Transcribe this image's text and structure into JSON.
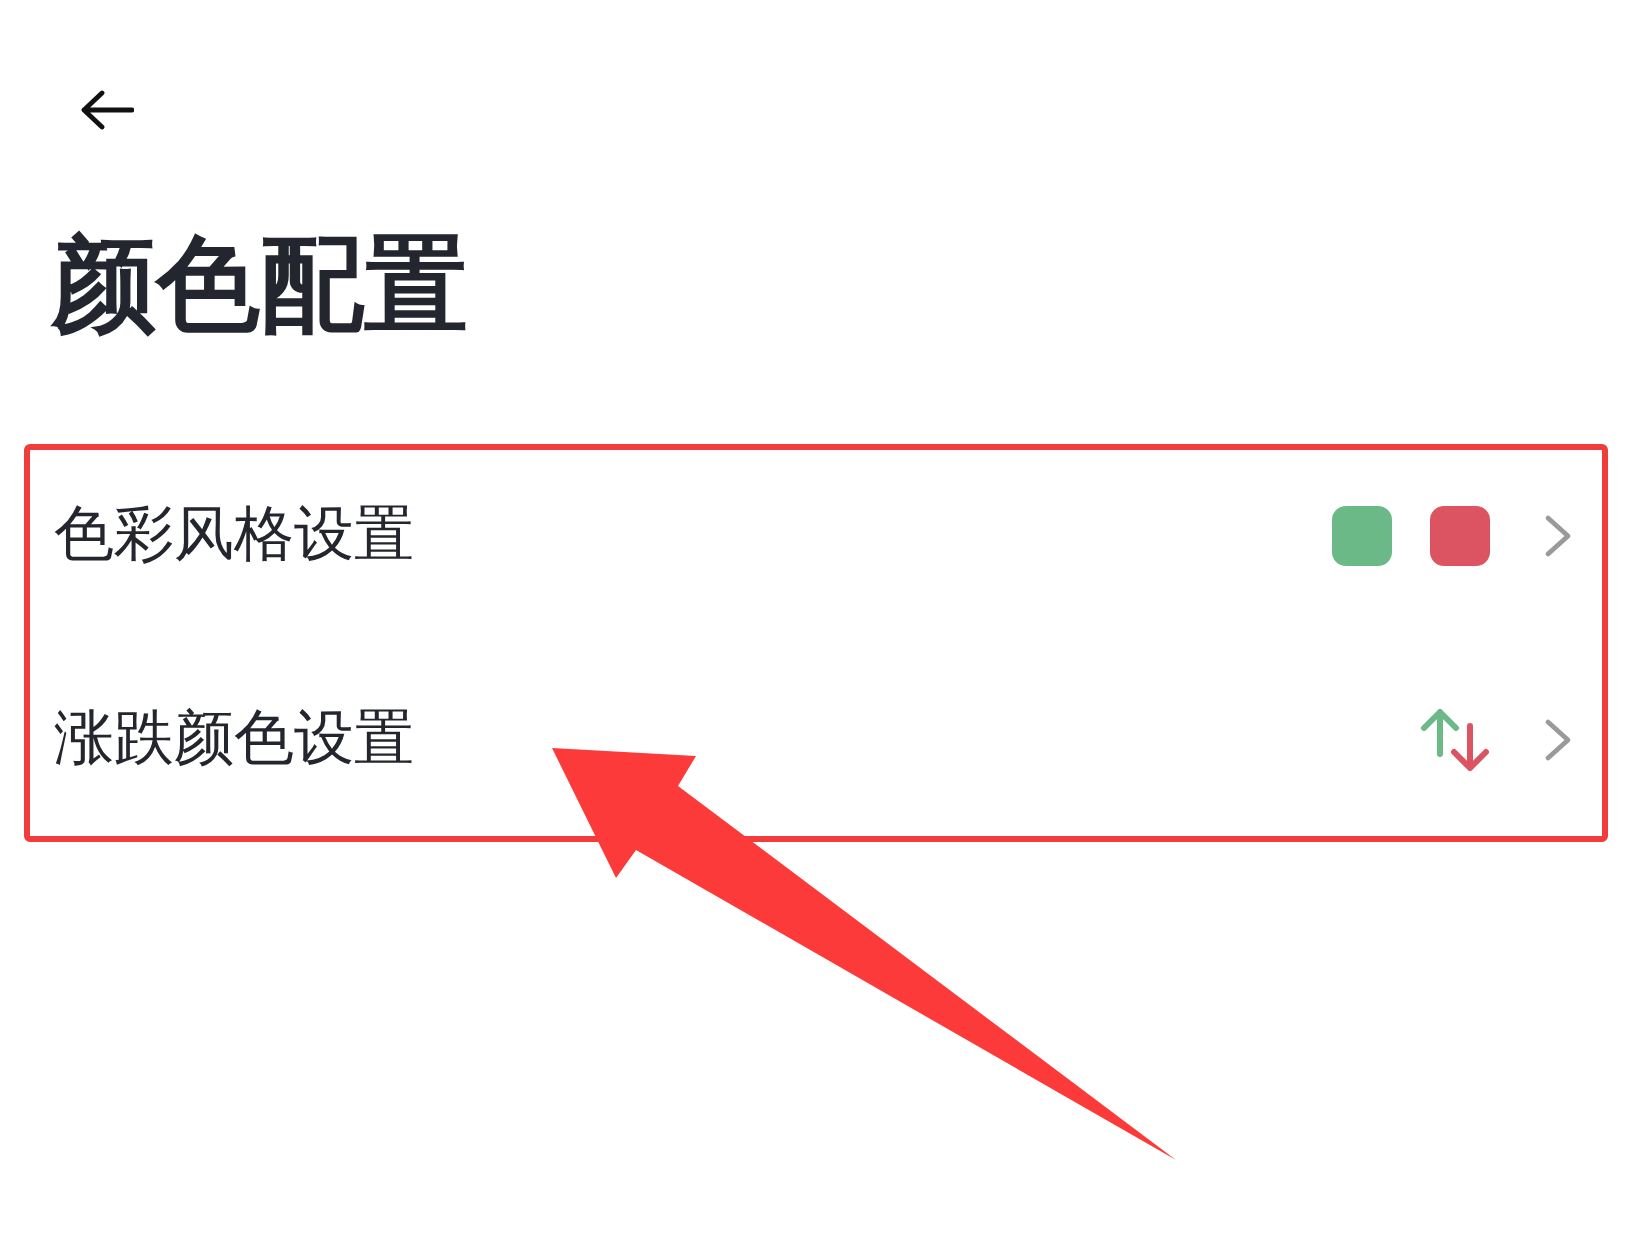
{
  "title": "颜色配置",
  "settings": {
    "highlighted": true,
    "items": [
      {
        "kind": "swatches",
        "label": "色彩风格设置",
        "swatches": [
          {
            "color": "#6ab987"
          },
          {
            "color": "#dc5461"
          }
        ]
      },
      {
        "kind": "trend",
        "label": "涨跌颜色设置"
      }
    ]
  },
  "annotations": [
    {
      "kind": "arrow"
    }
  ]
}
